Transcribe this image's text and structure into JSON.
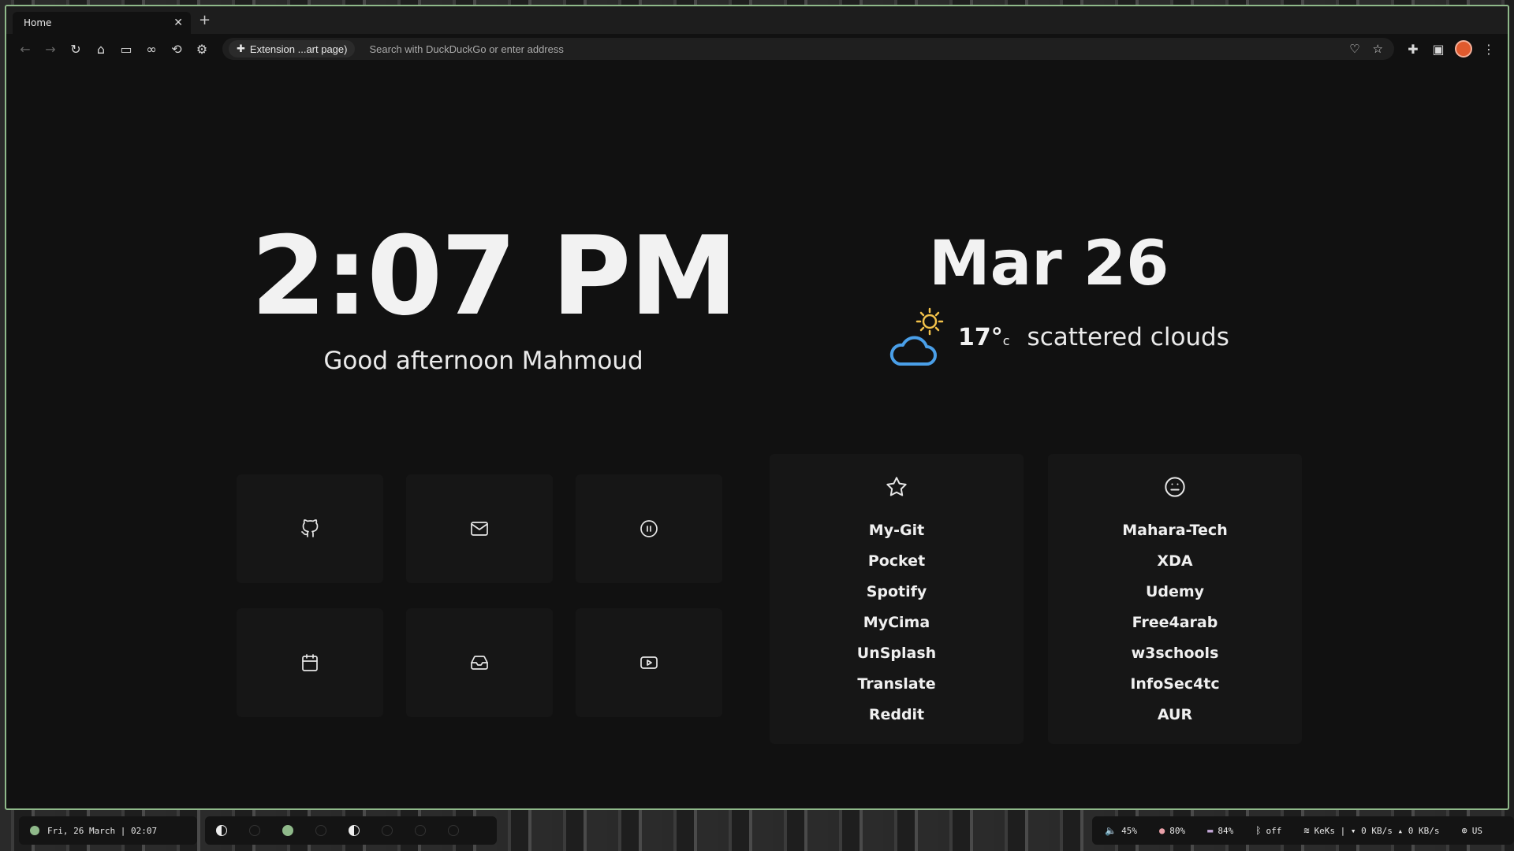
{
  "browser": {
    "tab_title": "Home",
    "tab_close": "✕",
    "new_tab": "+",
    "extension_chip": "Extension ...art page)",
    "address_placeholder": "Search with DuckDuckGo or enter address"
  },
  "dashboard": {
    "time": "2:07 PM",
    "greeting": "Good afternoon Mahmoud",
    "date": "Mar 26",
    "weather": {
      "temp": "17°",
      "unit": "c",
      "condition": "scattered clouds",
      "icon": "cloud-sun-icon"
    },
    "tiles": [
      {
        "icon": "github-icon"
      },
      {
        "icon": "mail-icon"
      },
      {
        "icon": "pause-circle-icon"
      },
      {
        "icon": "calendar-icon"
      },
      {
        "icon": "inbox-drive-icon"
      },
      {
        "icon": "youtube-icon"
      }
    ],
    "links_left": {
      "icon": "star-icon",
      "items": [
        "My-Git",
        "Pocket",
        "Spotify",
        "MyCima",
        "UnSplash",
        "Translate",
        "Reddit"
      ]
    },
    "links_right": {
      "icon": "meh-face-icon",
      "items": [
        "Mahara-Tech",
        "XDA",
        "Udemy",
        "Free4arab",
        "w3schools",
        "InfoSec4tc",
        "AUR"
      ]
    }
  },
  "taskbar": {
    "datetime": "Fri, 26 March | 02:07",
    "volume": "45%",
    "brightness": "80%",
    "battery": "84%",
    "bluetooth": "off",
    "network": "KeKs | ▾ 0 KB/s ▴ 0 KB/s",
    "keyboard": "US"
  },
  "colors": {
    "accent": "#8fb98a",
    "background": "#111111",
    "tile": "#161616",
    "weather_cloud": "#4a9fe8",
    "weather_sun": "#f3c24a"
  }
}
